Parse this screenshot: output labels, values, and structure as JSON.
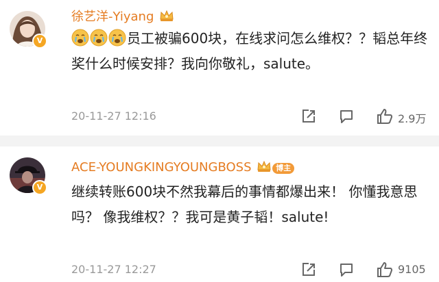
{
  "comments": [
    {
      "username": "徐艺洋-Yiyang",
      "verified_badge": "V",
      "text": "员工被骗600块，在线求问怎么维权？？韬总年终奖什么时候安排？我向你敬礼，salute。",
      "timestamp": "20-11-27 12:16",
      "likes": "2.9万",
      "emoji_icons": [
        "crying-face-icon",
        "crying-face-icon",
        "crying-face-icon"
      ],
      "badge_icon": "crown-icon"
    },
    {
      "username": "ACE-YOUNGKINGYOUNGBOSS",
      "verified_badge": "V",
      "role_badge": "博主",
      "text": "继续转账600块不然我幕后的事情都爆出来！ 你懂我意思吗？ 像我维权？？我可是黄子韬！salute!",
      "timestamp": "20-11-27 12:27",
      "likes": "9105",
      "badge_icon": "crown-icon"
    }
  ],
  "colors": {
    "username": "#e57c22",
    "timestamp": "#999999",
    "text": "#222222",
    "badge": "#f29a38",
    "divider": "#f3f3f3"
  }
}
